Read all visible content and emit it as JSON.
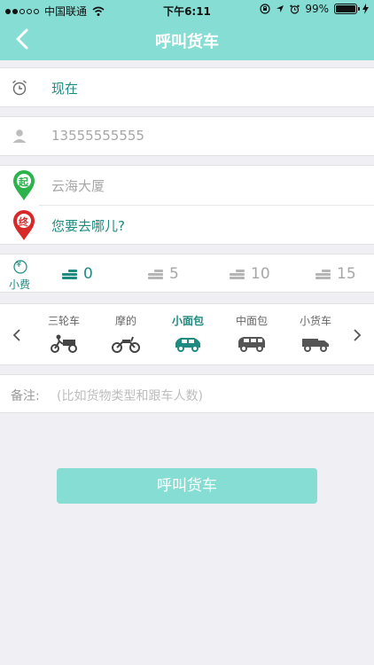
{
  "status": {
    "carrier": "中国联通",
    "time": "下午6:11",
    "battery": "99%"
  },
  "nav": {
    "title": "呼叫货车"
  },
  "rows": {
    "time": "现在",
    "phone": "13555555555",
    "from": "云海大厦",
    "to": "您要去哪儿?"
  },
  "pins": {
    "from_label": "起",
    "to_label": "终"
  },
  "tip": {
    "label": "小费",
    "currency_symbol": "¥",
    "options": [
      "0",
      "5",
      "10",
      "15"
    ],
    "selected_index": 0
  },
  "vehicles": [
    {
      "label": "三轮车",
      "icon": "tricycle-icon",
      "selected": false
    },
    {
      "label": "摩的",
      "icon": "motorcycle-icon",
      "selected": false
    },
    {
      "label": "小面包",
      "icon": "small-van-icon",
      "selected": true
    },
    {
      "label": "中面包",
      "icon": "medium-van-icon",
      "selected": false
    },
    {
      "label": "小货车",
      "icon": "small-truck-icon",
      "selected": false
    }
  ],
  "note": {
    "label": "备注:",
    "placeholder": "(比如货物类型和跟车人数)"
  },
  "cta": {
    "label": "呼叫货车"
  },
  "colors": {
    "accent": "#86ddd3",
    "teal_text": "#1f8a80",
    "pin_green": "#2eb24b",
    "pin_red": "#d8292a"
  }
}
